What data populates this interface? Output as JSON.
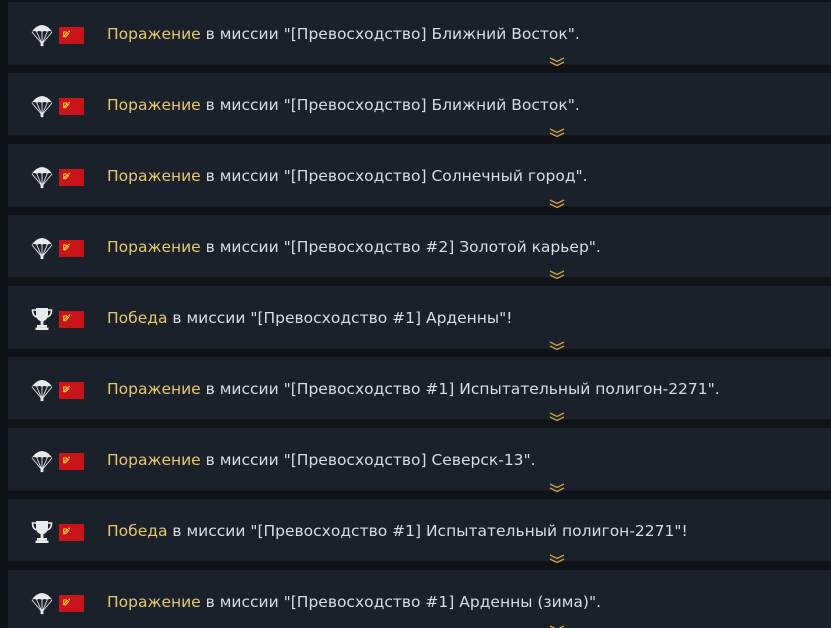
{
  "colors": {
    "background": "#0f1318",
    "row": "#1b212a",
    "result_highlight": "#e6c86f",
    "text": "#d9dde2",
    "flag_red": "#c8141a",
    "icon": "#e8eaec",
    "chevron": "#c9a04a"
  },
  "entries": [
    {
      "icon": "parachute-icon",
      "result": "Поражение",
      "text": " в миссии \"[Превосходство] Ближний Восток\"."
    },
    {
      "icon": "parachute-icon",
      "result": "Поражение",
      "text": " в миссии \"[Превосходство] Ближний Восток\"."
    },
    {
      "icon": "parachute-icon",
      "result": "Поражение",
      "text": " в миссии \"[Превосходство] Солнечный город\"."
    },
    {
      "icon": "parachute-icon",
      "result": "Поражение",
      "text": " в миссии \"[Превосходство #2] Золотой карьер\"."
    },
    {
      "icon": "trophy-icon",
      "result": "Победа",
      "text": " в миссии \"[Превосходство #1] Арденны\"!"
    },
    {
      "icon": "parachute-icon",
      "result": "Поражение",
      "text": " в миссии \"[Превосходство #1] Испытательный полигон-2271\"."
    },
    {
      "icon": "parachute-icon",
      "result": "Поражение",
      "text": " в миссии \"[Превосходство] Северск-13\"."
    },
    {
      "icon": "trophy-icon",
      "result": "Победа",
      "text": " в миссии \"[Превосходство #1] Испытательный полигон-2271\"!"
    },
    {
      "icon": "parachute-icon",
      "result": "Поражение",
      "text": " в миссии \"[Превосходство #1] Арденны (зима)\"."
    }
  ]
}
